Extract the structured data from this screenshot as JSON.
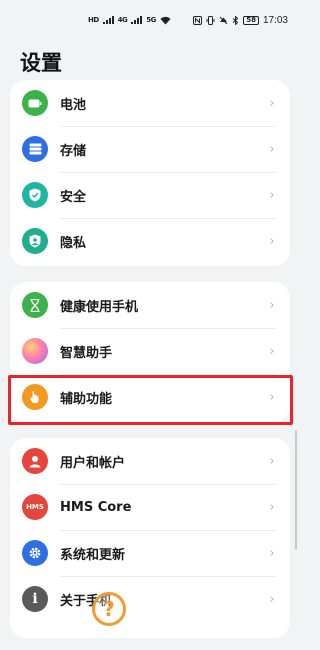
{
  "status_bar": {
    "left_label_a": "HD",
    "left_label_b": "4G",
    "left_label_c": "5G",
    "right_battery": "58",
    "time": "17:03"
  },
  "page": {
    "title": "设置"
  },
  "groups": [
    {
      "items": [
        {
          "label": "电池",
          "icon": "battery-icon",
          "color": "#3cb34a"
        },
        {
          "label": "存储",
          "icon": "storage-icon",
          "color": "#2f6fe4"
        },
        {
          "label": "安全",
          "icon": "shield-icon",
          "color": "#1fb5a3"
        },
        {
          "label": "隐私",
          "icon": "privacy-icon",
          "color": "#1fae8f"
        }
      ]
    },
    {
      "items": [
        {
          "label": "健康使用手机",
          "icon": "hourglass-icon",
          "color": "#3cb34a"
        },
        {
          "label": "智慧助手",
          "icon": "assistant-icon",
          "color": "#c278e0"
        },
        {
          "label": "辅助功能",
          "icon": "hand-icon",
          "color": "#f29a1f"
        }
      ]
    },
    {
      "items": [
        {
          "label": "用户和帐户",
          "icon": "user-icon",
          "color": "#e5453b"
        },
        {
          "label": "HMS Core",
          "icon": "hms-icon",
          "color": "#e5453b",
          "icon_text": "HMS"
        },
        {
          "label": "系统和更新",
          "icon": "gear-icon",
          "color": "#2f6fe4"
        },
        {
          "label": "关于手机",
          "icon": "info-icon",
          "color": "#5a5a5a"
        }
      ]
    }
  ],
  "chevron": "›",
  "help_float": {
    "glyph": "?"
  },
  "highlight_color": "#e8262a"
}
